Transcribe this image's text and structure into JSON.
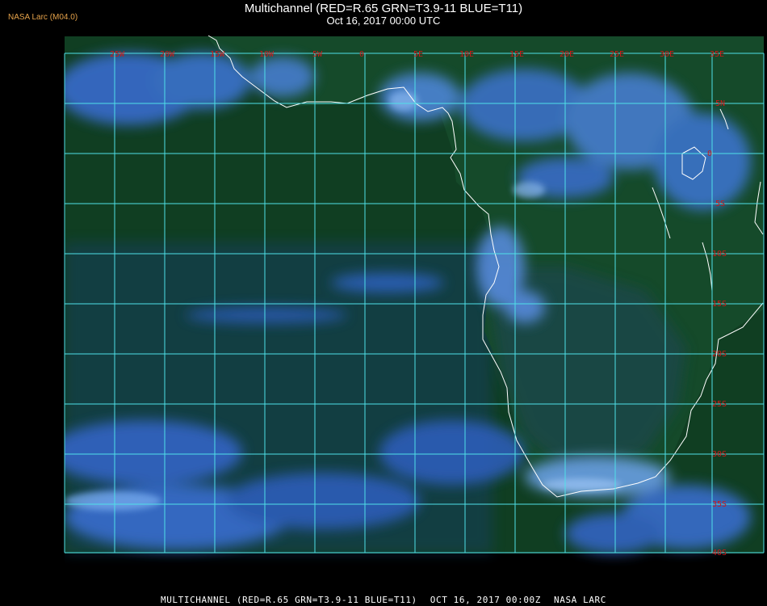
{
  "header": {
    "credit": "NASA Larc (M04.0)",
    "title": "Multichannel (RED=R.65 GRN=T3.9-11 BLUE=T11)",
    "subtitle": "Oct 16, 2017 00:00 UTC"
  },
  "map": {
    "lon_labels": [
      "25W",
      "20W",
      "15W",
      "10W",
      "5W",
      "0",
      "5E",
      "10E",
      "15E",
      "20E",
      "25E",
      "30E",
      "35E"
    ],
    "lat_labels": [
      "5N",
      "0",
      "5S",
      "10S",
      "15S",
      "20S",
      "25S",
      "30S",
      "35S",
      "40S"
    ],
    "colors": {
      "ocean": "#0f3f21",
      "land": "#175030",
      "cloud": "#2f6fcc",
      "grid": "#4fe0e8",
      "label": "#d01818",
      "coast": "#ffffff"
    }
  },
  "footer": {
    "product": "MULTICHANNEL (RED=R.65 GRN=T3.9-11 BLUE=T11)",
    "date": "OCT 16, 2017 00:00Z",
    "source": "NASA LARC"
  }
}
